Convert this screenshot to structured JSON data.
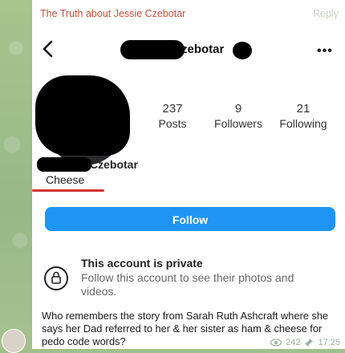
{
  "reply": {
    "author": "The Truth about Jessie Czebotar",
    "action": "Reply"
  },
  "profile": {
    "username_visible": "zebotar",
    "display_name_visible": "Czebotar",
    "bio": "Cheese",
    "stats": [
      {
        "value": "237",
        "label": "Posts"
      },
      {
        "value": "9",
        "label": "Followers"
      },
      {
        "value": "21",
        "label": "Following"
      }
    ],
    "follow_label": "Follow",
    "private_title": "This account is private",
    "private_text": "Follow this account to see their photos and videos."
  },
  "message": {
    "text": "Who remembers the story from Sarah Ruth Ashcraft where she says her Dad referred to her & her sister as ham & cheese for pedo code words?",
    "views": "242",
    "time": "17:25"
  },
  "icons": [
    "back-arrow-icon",
    "more-options-icon",
    "lock-icon",
    "eye-icon",
    "pin-icon"
  ]
}
